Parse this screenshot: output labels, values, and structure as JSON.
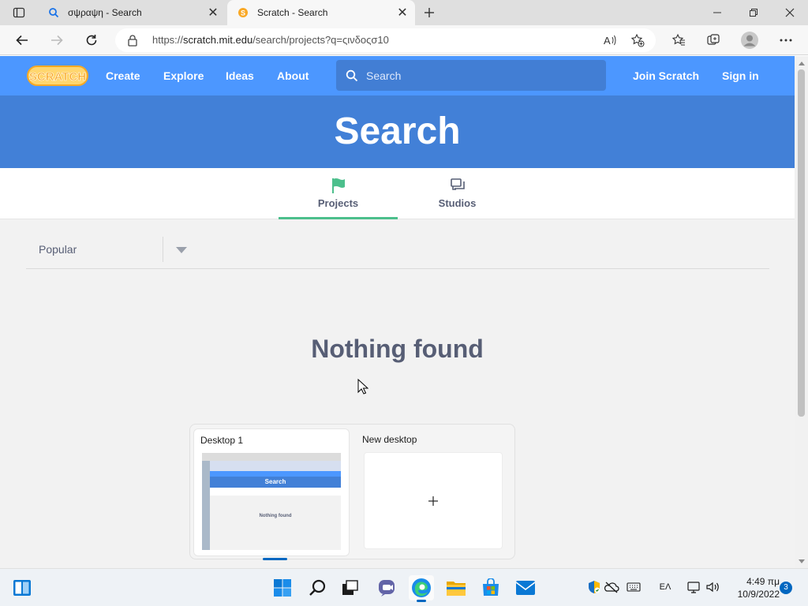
{
  "browser": {
    "tabs": [
      {
        "title": "σψραψη - Search",
        "state": "inactive"
      },
      {
        "title": "Scratch - Search",
        "state": "active"
      }
    ],
    "url_prefix": "https://",
    "url_host": "scratch.mit.edu",
    "url_path": "/search/projects?q=ςινδοςσ10"
  },
  "scratch_nav": {
    "logo_text": "SCRATCH",
    "links": [
      "Create",
      "Explore",
      "Ideas",
      "About"
    ],
    "search_placeholder": "Search",
    "join": "Join Scratch",
    "signin": "Sign in"
  },
  "page": {
    "heading": "Search",
    "tabs": [
      "Projects",
      "Studios"
    ],
    "active_tab": "Projects",
    "sort_selected": "Popular",
    "empty_message": "Nothing found"
  },
  "task_view": {
    "desktops": [
      "Desktop 1",
      "New desktop"
    ],
    "thumbnail_heading": "Search",
    "thumbnail_message": "Nothing found"
  },
  "taskbar": {
    "language": "ΕΛ",
    "time": "4:49 πμ",
    "date": "10/9/2022",
    "notifications": "3"
  },
  "colors": {
    "scratch_blue": "#4c97ff",
    "banner_blue": "#4280d7",
    "tab_underline": "#4cbf8c",
    "text_gray": "#575e75"
  }
}
